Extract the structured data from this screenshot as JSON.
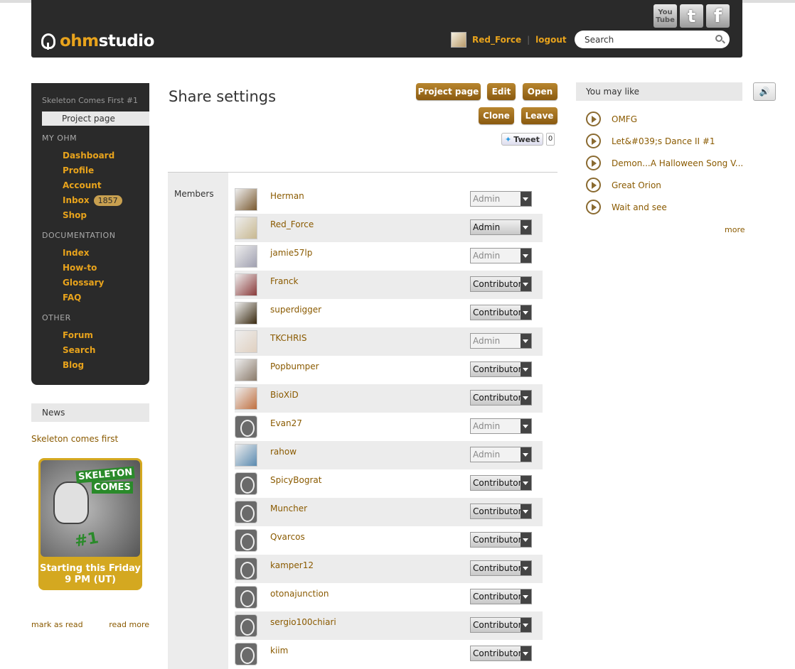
{
  "header": {
    "logo_ohm": "ohm",
    "logo_studio": "studio",
    "social": {
      "youtube": "You Tube",
      "twitter": "t",
      "facebook": "f"
    },
    "user_name": "Red_Force",
    "separator": "|",
    "logout": "logout",
    "search_placeholder": "Search"
  },
  "sidebar": {
    "project_name": "Skeleton Comes First #1",
    "project_page": "Project page",
    "sections": [
      {
        "title": "MY OHM",
        "items": [
          "Dashboard",
          "Profile",
          "Account",
          "Inbox",
          "Shop"
        ]
      },
      {
        "title": "DOCUMENTATION",
        "items": [
          "Index",
          "How-to",
          "Glossary",
          "FAQ"
        ]
      },
      {
        "title": "OTHER",
        "items": [
          "Forum",
          "Search",
          "Blog"
        ]
      }
    ],
    "inbox_count": "1857"
  },
  "news": {
    "header": "News",
    "title": "Skeleton comes first",
    "card_skeleton": "SKELETON",
    "card_comes": "COMES",
    "card_number": "#1",
    "card_caption": "Starting this Friday 9 PM (UT)",
    "mark_as_read": "mark as read",
    "read_more": "read more"
  },
  "main": {
    "title": "Share settings",
    "buttons": {
      "project_page": "Project page",
      "edit": "Edit",
      "open": "Open",
      "clone": "Clone",
      "leave": "Leave"
    },
    "tweet": {
      "label": "Tweet",
      "count": "0"
    },
    "members_label": "Members",
    "members": [
      {
        "name": "Herman",
        "role": "Admin",
        "style": "light",
        "avatar": "custom"
      },
      {
        "name": "Red_Force",
        "role": "Admin",
        "style": "dark",
        "avatar": "custom"
      },
      {
        "name": "jamie57lp",
        "role": "Admin",
        "style": "light",
        "avatar": "custom"
      },
      {
        "name": "Franck",
        "role": "Contributor",
        "style": "dark",
        "avatar": "custom"
      },
      {
        "name": "superdigger",
        "role": "Contributor",
        "style": "dark",
        "avatar": "custom"
      },
      {
        "name": "TKCHRIS",
        "role": "Admin",
        "style": "light",
        "avatar": "custom"
      },
      {
        "name": "Popbumper",
        "role": "Contributor",
        "style": "dark",
        "avatar": "custom"
      },
      {
        "name": "BioXiD",
        "role": "Contributor",
        "style": "dark",
        "avatar": "custom"
      },
      {
        "name": "Evan27",
        "role": "Admin",
        "style": "light",
        "avatar": "default"
      },
      {
        "name": "rahow",
        "role": "Admin",
        "style": "light",
        "avatar": "custom"
      },
      {
        "name": "SpicyBograt",
        "role": "Contributor",
        "style": "dark",
        "avatar": "default"
      },
      {
        "name": "Muncher",
        "role": "Contributor",
        "style": "dark",
        "avatar": "default"
      },
      {
        "name": "Qvarcos",
        "role": "Contributor",
        "style": "dark",
        "avatar": "default"
      },
      {
        "name": "kamper12",
        "role": "Contributor",
        "style": "dark",
        "avatar": "default"
      },
      {
        "name": "otonajunction",
        "role": "Contributor",
        "style": "dark",
        "avatar": "default"
      },
      {
        "name": "sergio100chiari",
        "role": "Contributor",
        "style": "dark",
        "avatar": "default"
      },
      {
        "name": "kiim",
        "role": "Contributor",
        "style": "dark",
        "avatar": "default"
      }
    ]
  },
  "right": {
    "header": "You may like",
    "sound_icon": "speaker-icon",
    "items": [
      "OMFG",
      "Let&#039;s Dance II #1",
      "Demon...A Halloween Song V...",
      "Great Orion",
      "Wait and see"
    ],
    "more": "more"
  },
  "colors": {
    "accent": "#e8a31c",
    "link": "#8a5a00",
    "dark": "#2a2a2a",
    "button": "#a0701f"
  }
}
